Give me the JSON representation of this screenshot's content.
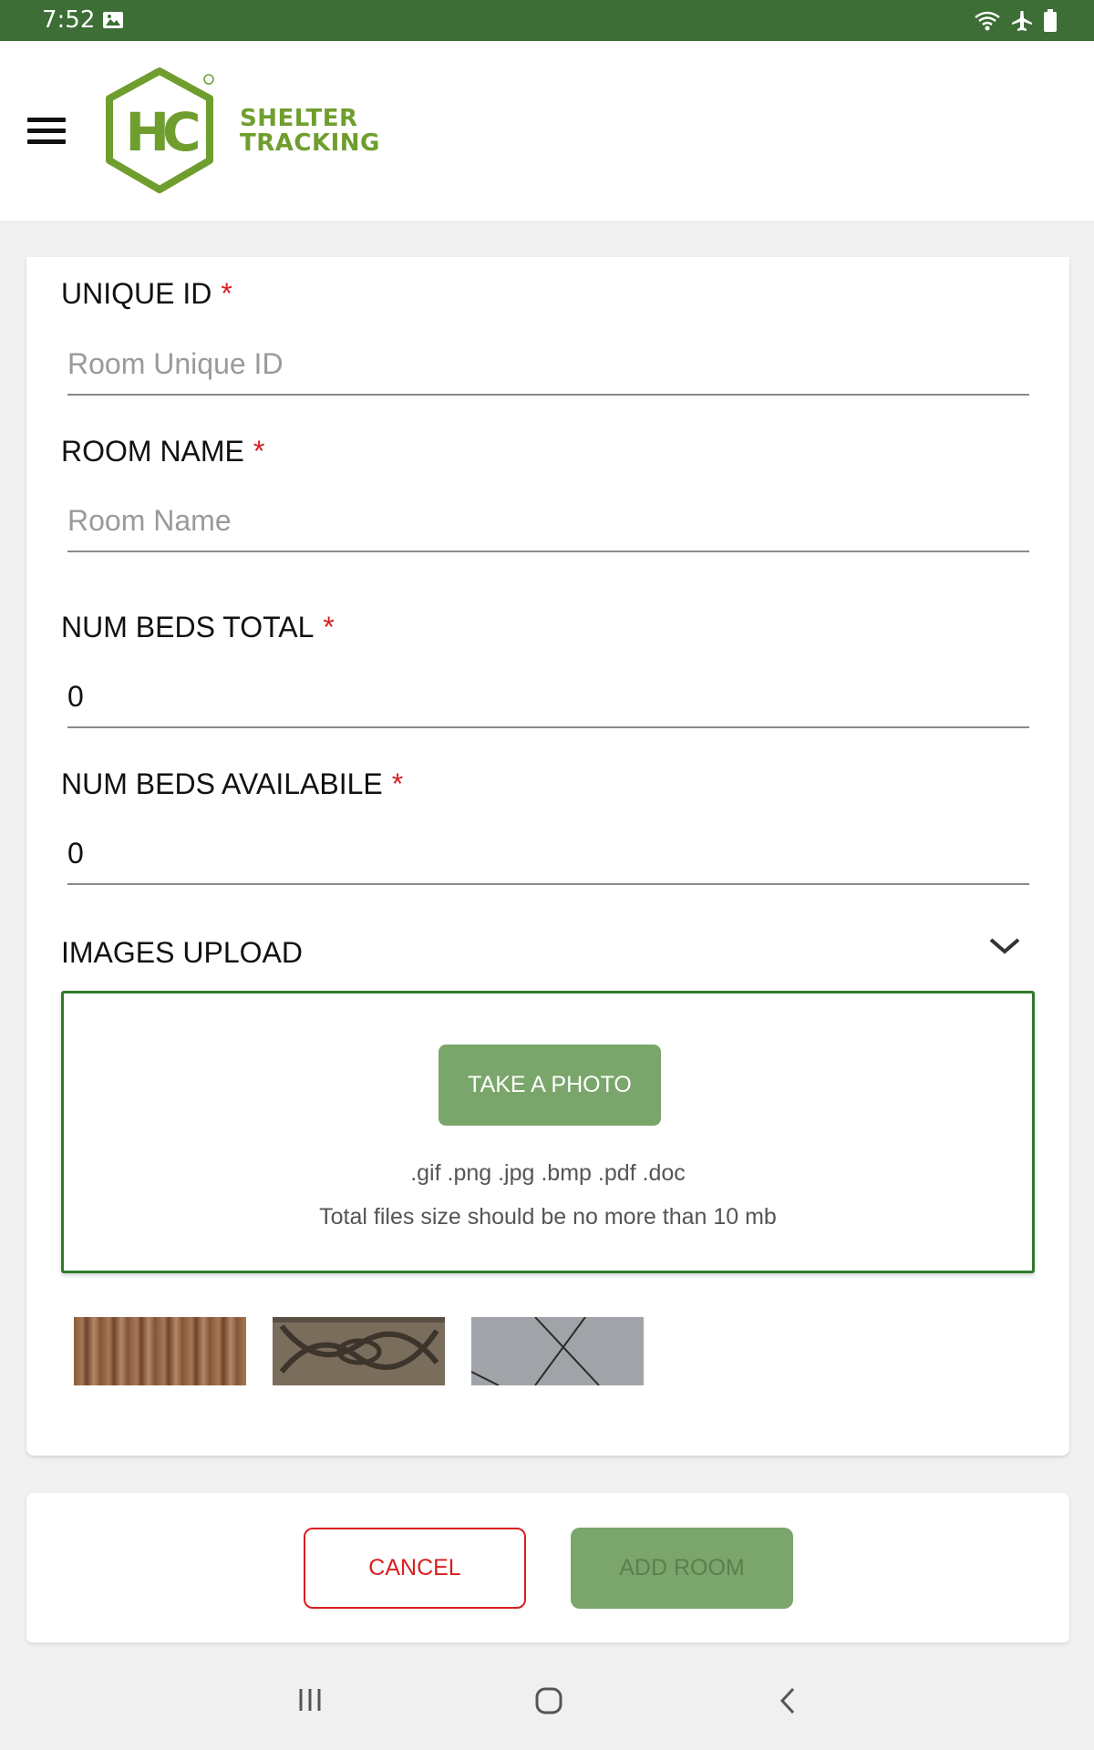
{
  "status_bar": {
    "time": "7:52",
    "icons": [
      "image-icon",
      "wifi-icon",
      "airplane-mode-icon",
      "battery-icon"
    ]
  },
  "header": {
    "menu_icon": "hamburger-menu-icon",
    "logo_letters": "HC",
    "logo_line1": "SHELTER",
    "logo_line2": "TRACKING",
    "brand_color": "#6f9e2e"
  },
  "form": {
    "unique_id": {
      "label": "UNIQUE ID",
      "required_mark": "*",
      "placeholder": "Room Unique ID",
      "value": ""
    },
    "room_name": {
      "label": "ROOM NAME",
      "required_mark": "*",
      "placeholder": "Room Name",
      "value": ""
    },
    "num_beds_total": {
      "label": "NUM BEDS TOTAL",
      "required_mark": "*",
      "value": "0"
    },
    "num_beds_available": {
      "label": "NUM BEDS AVAILABILE",
      "required_mark": "*",
      "value": "0"
    }
  },
  "images_upload": {
    "label": "IMAGES UPLOAD",
    "toggle_icon": "chevron-down-icon",
    "take_photo_label": "TAKE A PHOTO",
    "file_types": ".gif .png .jpg .bmp .pdf .doc",
    "size_note": "Total files size should be no more than 10 mb",
    "thumbnails": [
      "wood-floor",
      "patterned-carpet",
      "grey-tile"
    ]
  },
  "actions": {
    "cancel_label": "CANCEL",
    "add_room_label": "ADD ROOM"
  },
  "nav_bar": {
    "icons": [
      "recent-apps-icon",
      "home-icon",
      "back-icon"
    ]
  },
  "colors": {
    "status_bar": "#3c6e35",
    "accent_green": "#7aa66b",
    "border_green": "#2f7a2a",
    "required_red": "#d81f1f"
  }
}
